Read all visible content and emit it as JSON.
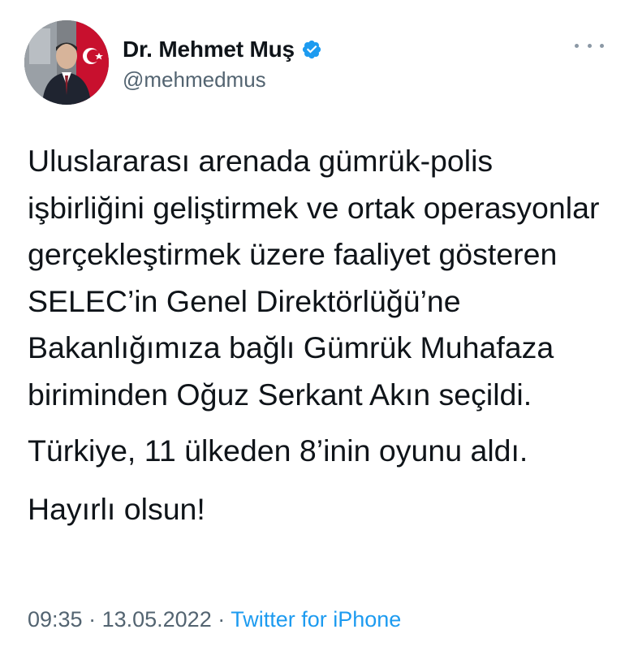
{
  "author": {
    "display_name": "Dr. Mehmet Muş",
    "handle": "@mehmedmus",
    "verified_icon": "verified-badge-icon",
    "avatar_icon": "profile-photo"
  },
  "menu": {
    "more_icon": "more-options-icon"
  },
  "tweet": {
    "paragraph_1": "Uluslararası arenada gümrük-polis işbirliğini geliştirmek ve ortak operasyonlar gerçekleştirmek üzere faaliyet gösteren SELEC’in Genel Direktörlüğü’ne Bakanlığımıza bağlı Gümrük Muhafaza biriminden Oğuz Serkant Akın seçildi.",
    "paragraph_2": "Türkiye, 11 ülkeden 8’inin oyunu aldı.",
    "paragraph_3": "Hayırlı olsun!"
  },
  "meta": {
    "time": "09:35",
    "separator_1": " · ",
    "date": "13.05.2022",
    "separator_2": " · ",
    "source": "Twitter for iPhone"
  },
  "colors": {
    "accent": "#1d9bf0",
    "text": "#0f1419",
    "secondary": "#536471"
  }
}
